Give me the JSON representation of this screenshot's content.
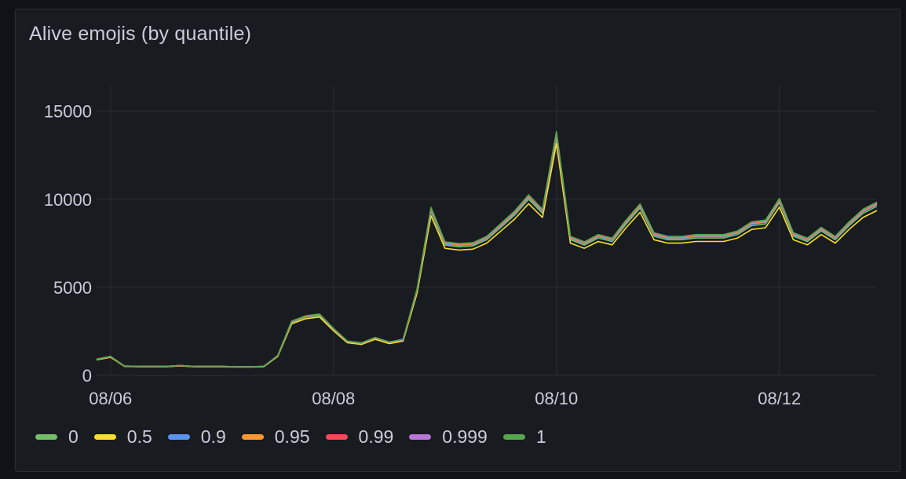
{
  "panel": {
    "title": "Alive emojis (by quantile)"
  },
  "chart_data": {
    "type": "line",
    "title": "Alive emojis (by quantile)",
    "xlabel": "",
    "ylabel": "",
    "x_ticks": [
      "08/06",
      "08/08",
      "08/10",
      "08/12"
    ],
    "y_ticks": [
      0,
      5000,
      10000,
      15000
    ],
    "x_range": [
      "2024-08-05T21:00",
      "2024-08-12T21:00"
    ],
    "ylim": [
      0,
      16500
    ],
    "grid": true,
    "legend": "bottom-left",
    "series": [
      {
        "name": "0",
        "color": "#73bf69"
      },
      {
        "name": "0.5",
        "color": "#fade2a"
      },
      {
        "name": "0.9",
        "color": "#5794f2"
      },
      {
        "name": "0.95",
        "color": "#ff9830"
      },
      {
        "name": "0.99",
        "color": "#f2495c"
      },
      {
        "name": "0.999",
        "color": "#b877d9"
      },
      {
        "name": "1",
        "color": "#56a64b"
      }
    ],
    "x": [
      "2024-08-05T21:00",
      "2024-08-06T00:00",
      "2024-08-06T03:00",
      "2024-08-06T06:00",
      "2024-08-06T09:00",
      "2024-08-06T12:00",
      "2024-08-06T15:00",
      "2024-08-06T18:00",
      "2024-08-06T21:00",
      "2024-08-07T00:00",
      "2024-08-07T03:00",
      "2024-08-07T06:00",
      "2024-08-07T09:00",
      "2024-08-07T12:00",
      "2024-08-07T15:00",
      "2024-08-07T18:00",
      "2024-08-07T21:00",
      "2024-08-08T00:00",
      "2024-08-08T03:00",
      "2024-08-08T06:00",
      "2024-08-08T09:00",
      "2024-08-08T12:00",
      "2024-08-08T15:00",
      "2024-08-08T18:00",
      "2024-08-08T21:00",
      "2024-08-09T00:00",
      "2024-08-09T03:00",
      "2024-08-09T06:00",
      "2024-08-09T09:00",
      "2024-08-09T12:00",
      "2024-08-09T15:00",
      "2024-08-09T18:00",
      "2024-08-09T21:00",
      "2024-08-10T00:00",
      "2024-08-10T03:00",
      "2024-08-10T06:00",
      "2024-08-10T09:00",
      "2024-08-10T12:00",
      "2024-08-10T15:00",
      "2024-08-10T18:00",
      "2024-08-10T21:00",
      "2024-08-11T00:00",
      "2024-08-11T03:00",
      "2024-08-11T06:00",
      "2024-08-11T09:00",
      "2024-08-11T12:00",
      "2024-08-11T15:00",
      "2024-08-11T18:00",
      "2024-08-11T21:00",
      "2024-08-12T00:00",
      "2024-08-12T03:00",
      "2024-08-12T06:00",
      "2024-08-12T09:00",
      "2024-08-12T12:00",
      "2024-08-12T15:00",
      "2024-08-12T18:00",
      "2024-08-12T21:00"
    ],
    "values": [
      900,
      1050,
      520,
      500,
      500,
      500,
      550,
      500,
      500,
      500,
      480,
      480,
      500,
      1100,
      3000,
      3300,
      3400,
      2600,
      1900,
      1800,
      2100,
      1850,
      2000,
      4800,
      9300,
      7400,
      7300,
      7350,
      7700,
      8400,
      9100,
      10000,
      9200,
      13500,
      7700,
      7400,
      7800,
      7600,
      8600,
      9500,
      7900,
      7700,
      7700,
      7800,
      7800,
      7800,
      8000,
      8500,
      8600,
      9800,
      7900,
      7600,
      8200,
      7700,
      8500,
      9200,
      9600
    ]
  }
}
